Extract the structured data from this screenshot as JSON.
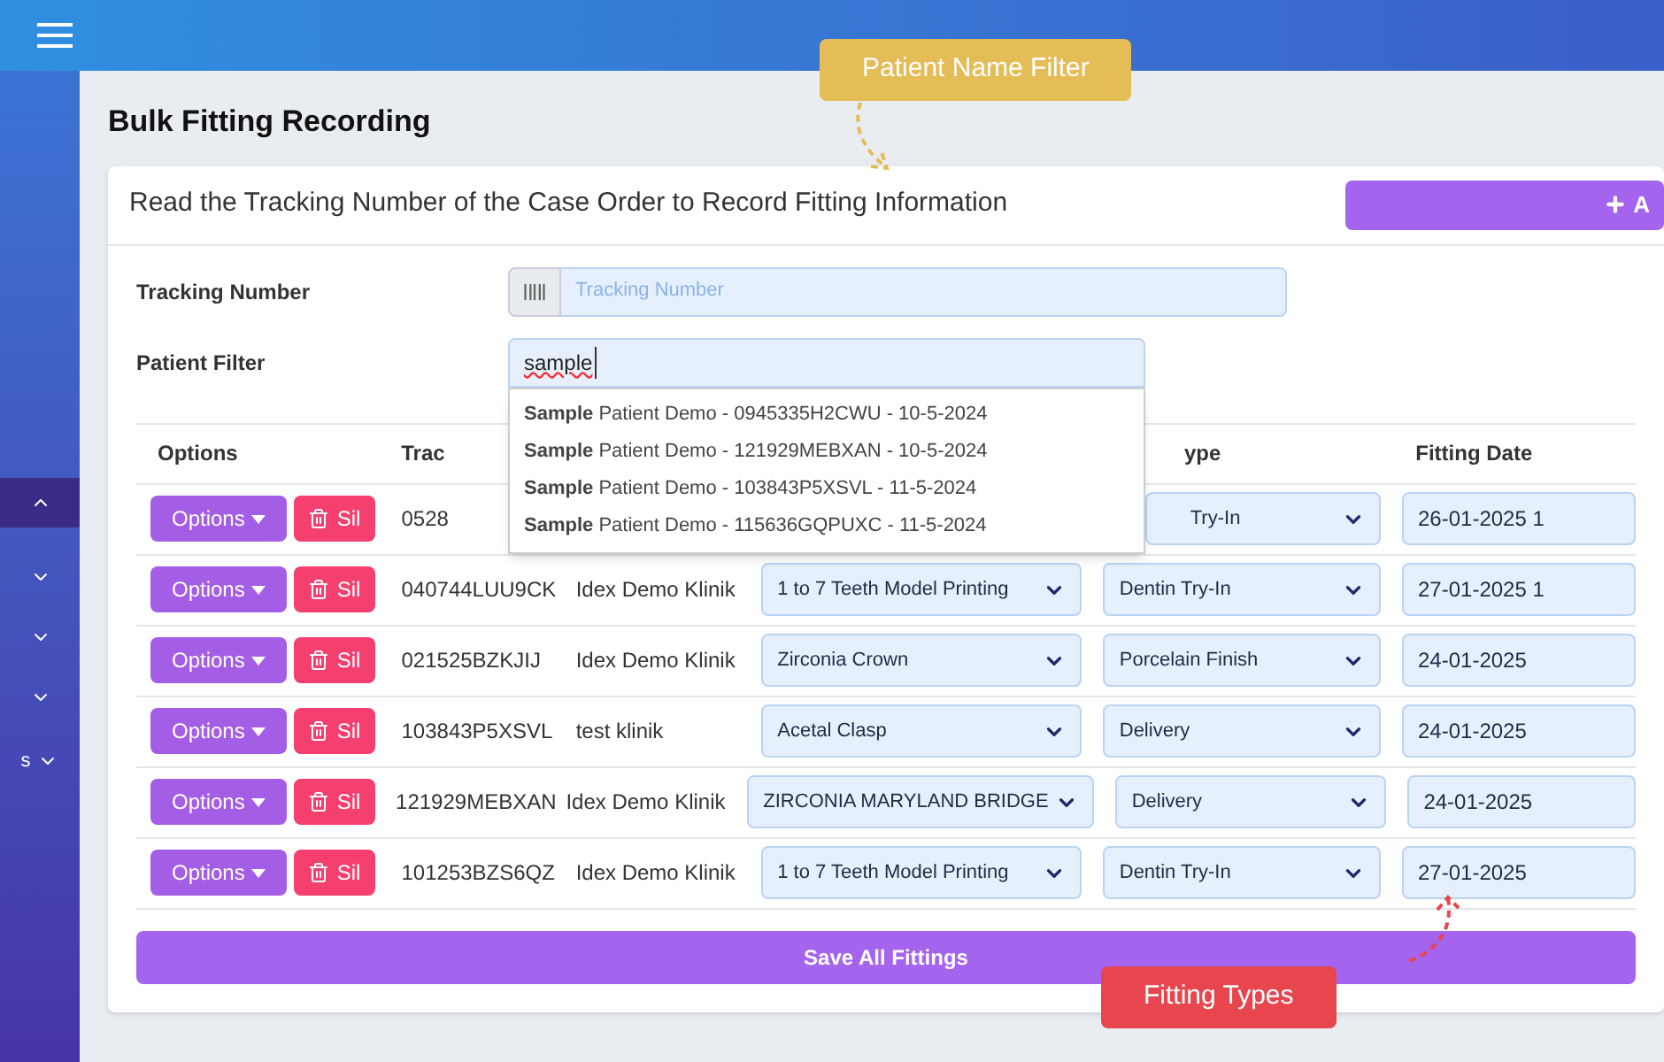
{
  "sidebar": {
    "items": [
      {
        "expanded": true
      },
      {
        "expanded": false
      },
      {
        "expanded": false
      },
      {
        "expanded": false
      },
      {
        "expanded": false,
        "label": "s"
      }
    ]
  },
  "page_title": "Bulk Fitting Recording",
  "card": {
    "title": "Read the Tracking Number of the Case Order to Record Fitting Information",
    "add_button": {
      "label": "A"
    },
    "tracking_field": {
      "label": "Tracking Number",
      "placeholder": "Tracking Number"
    },
    "patient_filter": {
      "label": "Patient Filter",
      "value": "sample",
      "spellcheck_error": true,
      "options": [
        {
          "text": "**Sample** Patient Demo - 0945335H2CWU - 10-5-2024",
          "selected": false
        },
        {
          "text": "**Sample** Patient Demo - 121929MEBXAN - 10-5-2024",
          "selected": false
        },
        {
          "text": "**Sample** Patient Demo - 103843P5XSVL - 11-5-2024",
          "selected": false
        },
        {
          "text": "**Sample** Patient Demo - 115636GQPUXC - 11-5-2024",
          "selected": false
        }
      ]
    },
    "table": {
      "columns": {
        "options": "Options",
        "tracking": "Trac",
        "fitting_type": "ype",
        "fitting_date": "Fitting Date"
      },
      "rows": [
        {
          "options_button": "Options",
          "delete_button": "Sil",
          "tracking": "0528",
          "fitting_type": "Try-In",
          "fitting_date": "26-01-2025 1"
        },
        {
          "options_button": "Options",
          "delete_button": "Sil",
          "tracking": "040744LUU9CK",
          "clinic": "Idex Demo Klinik",
          "product": "1 to 7 Teeth Model Printing",
          "fitting_type": "Dentin Try-In",
          "fitting_date": "27-01-2025 1"
        },
        {
          "options_button": "Options",
          "delete_button": "Sil",
          "tracking": "021525BZKJIJ",
          "clinic": "Idex Demo Klinik",
          "product": "Zirconia Crown",
          "fitting_type": "Porcelain Finish",
          "fitting_date": "24-01-2025"
        },
        {
          "options_button": "Options",
          "delete_button": "Sil",
          "tracking": "103843P5XSVL",
          "clinic": "test klinik",
          "product": "Acetal Clasp",
          "fitting_type": "Delivery",
          "fitting_date": "24-01-2025"
        },
        {
          "options_button": "Options",
          "delete_button": "Sil",
          "tracking": "121929MEBXAN",
          "clinic": "Idex Demo Klinik",
          "product": "ZIRCONIA MARYLAND BRIDGE",
          "fitting_type": "Delivery",
          "fitting_date": "24-01-2025"
        },
        {
          "options_button": "Options",
          "delete_button": "Sil",
          "tracking": "101253BZS6QZ",
          "clinic": "Idex Demo Klinik",
          "product": "1 to 7 Teeth Model Printing",
          "fitting_type": "Dentin Try-In",
          "fitting_date": "27-01-2025"
        }
      ]
    },
    "save_button": "Save All Fittings"
  },
  "annotations": [
    {
      "label": "Patient Name Filter",
      "color": "#e5bd57"
    },
    {
      "label": "Fitting Types",
      "color": "#e8464f"
    }
  ]
}
